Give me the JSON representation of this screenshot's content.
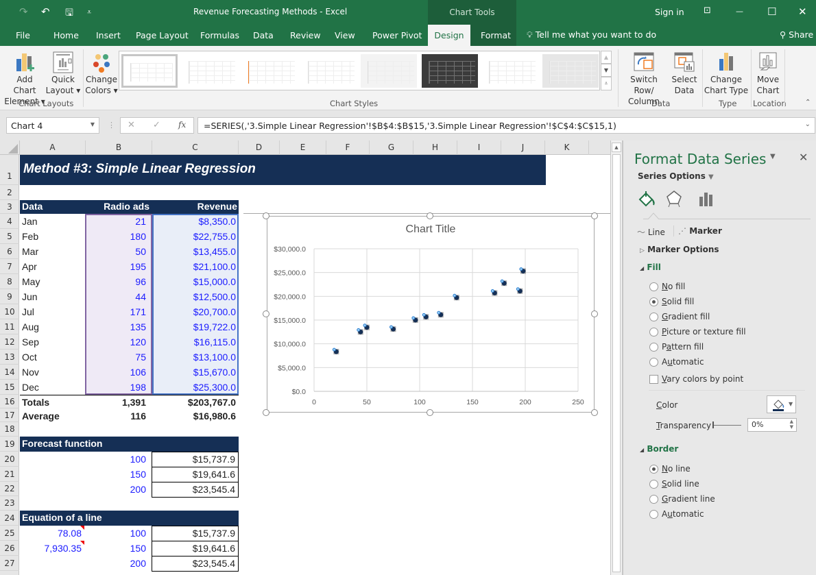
{
  "titlebar": {
    "title": "Revenue Forecasting Methods  -  Excel",
    "context_tab": "Chart Tools",
    "sign_in": "Sign in",
    "redo_icon": "↷",
    "undo_icon": "↶",
    "save_icon": "🖫",
    "customize_icon": "⩡",
    "ribbon_display_icon": "⊡",
    "minimize_icon": "—",
    "maximize_icon": "☐",
    "close_icon": "✕"
  },
  "tabs": {
    "items": [
      "File",
      "Home",
      "Insert",
      "Page Layout",
      "Formulas",
      "Data",
      "Review",
      "View",
      "Power Pivot",
      "Design",
      "Format"
    ],
    "active": "Design",
    "tell_me": "Tell me what you want to do",
    "share": "Share"
  },
  "ribbon": {
    "add_chart_element": [
      "Add Chart",
      "Element ▾"
    ],
    "quick_layout": [
      "Quick",
      "Layout ▾"
    ],
    "change_colors": [
      "Change",
      "Colors ▾"
    ],
    "chart_layouts_label": "Chart Layouts",
    "chart_styles_label": "Chart Styles",
    "switch_row_column": [
      "Switch Row/",
      "Column"
    ],
    "select_data": [
      "Select",
      "Data"
    ],
    "change_chart_type": [
      "Change",
      "Chart Type"
    ],
    "move_chart": [
      "Move",
      "Chart"
    ],
    "data_group_label": "Data",
    "type_group_label": "Type",
    "location_group_label": "Location",
    "chart_style_count": 8,
    "selected_style": 1
  },
  "formula_bar": {
    "name_box": "Chart 4",
    "formula": "=SERIES(,'3.Simple Linear Regression'!$B$4:$B$15,'3.Simple Linear Regression'!$C$4:$C$15,1)",
    "cancel_icon": "✕",
    "enter_icon": "✓",
    "fx_icon": "fx"
  },
  "columns": [
    "A",
    "B",
    "C",
    "D",
    "E",
    "F",
    "G",
    "H",
    "I",
    "J",
    "K"
  ],
  "rows": [
    "1",
    "2",
    "3",
    "4",
    "5",
    "6",
    "7",
    "8",
    "9",
    "10",
    "11",
    "12",
    "13",
    "14",
    "15",
    "16",
    "17",
    "18",
    "19",
    "20",
    "21",
    "22",
    "23",
    "24",
    "25",
    "26",
    "27"
  ],
  "sheet": {
    "title": "Method #3: Simple Linear Regression",
    "headers": {
      "data": "Data",
      "radio_ads": "Radio ads",
      "revenue": "Revenue"
    },
    "data_rows": [
      {
        "month": "Jan",
        "ads": "21",
        "revenue": "$8,350.0"
      },
      {
        "month": "Feb",
        "ads": "180",
        "revenue": "$22,755.0"
      },
      {
        "month": "Mar",
        "ads": "50",
        "revenue": "$13,455.0"
      },
      {
        "month": "Apr",
        "ads": "195",
        "revenue": "$21,100.0"
      },
      {
        "month": "May",
        "ads": "96",
        "revenue": "$15,000.0"
      },
      {
        "month": "Jun",
        "ads": "44",
        "revenue": "$12,500.0"
      },
      {
        "month": "Jul",
        "ads": "171",
        "revenue": "$20,700.0"
      },
      {
        "month": "Aug",
        "ads": "135",
        "revenue": "$19,722.0"
      },
      {
        "month": "Sep",
        "ads": "120",
        "revenue": "$16,115.0"
      },
      {
        "month": "Oct",
        "ads": "75",
        "revenue": "$13,100.0"
      },
      {
        "month": "Nov",
        "ads": "106",
        "revenue": "$15,670.0"
      },
      {
        "month": "Dec",
        "ads": "198",
        "revenue": "$25,300.0"
      }
    ],
    "totals": {
      "label": "Totals",
      "ads": "1,391",
      "revenue": "$203,767.0"
    },
    "average": {
      "label": "Average",
      "ads": "116",
      "revenue": "$16,980.6"
    },
    "forecast": {
      "title": "Forecast function",
      "rows": [
        {
          "x": "100",
          "y": "$15,737.9"
        },
        {
          "x": "150",
          "y": "$19,641.6"
        },
        {
          "x": "200",
          "y": "$23,545.4"
        }
      ]
    },
    "equation": {
      "title": "Equation of a line",
      "slope": "78.08",
      "intercept": "7,930.35",
      "rows": [
        {
          "x": "100",
          "y": "$15,737.9"
        },
        {
          "x": "150",
          "y": "$19,641.6"
        },
        {
          "x": "200",
          "y": "$23,545.4"
        }
      ]
    }
  },
  "chart_data": {
    "type": "scatter",
    "title": "Chart Title",
    "xlabel": "",
    "ylabel": "",
    "xlim": [
      0,
      250
    ],
    "ylim": [
      0,
      30000
    ],
    "xticks": [
      "0",
      "50",
      "100",
      "150",
      "200",
      "250"
    ],
    "yticks": [
      "$0.0",
      "$5,000.0",
      "$10,000.0",
      "$15,000.0",
      "$20,000.0",
      "$25,000.0",
      "$30,000.0"
    ],
    "grid": true,
    "legend": "none",
    "series": [
      {
        "name": "Revenue",
        "color": "#152f55",
        "x": [
          21,
          180,
          50,
          195,
          96,
          44,
          171,
          135,
          120,
          75,
          106,
          198
        ],
        "y": [
          8350,
          22755,
          13455,
          21100,
          15000,
          12500,
          20700,
          19722,
          16115,
          13100,
          15670,
          25300
        ]
      }
    ]
  },
  "pane": {
    "title": "Format Data Series",
    "series_options": "Series Options",
    "line_tab": "Line",
    "marker_tab": "Marker",
    "marker_options": "Marker Options",
    "fill_label": "Fill",
    "fill_options": [
      {
        "pre": "",
        "u": "N",
        "post": "o fill",
        "checked": false
      },
      {
        "pre": "",
        "u": "S",
        "post": "olid fill",
        "checked": true
      },
      {
        "pre": "",
        "u": "G",
        "post": "radient fill",
        "checked": false
      },
      {
        "pre": "",
        "u": "P",
        "post": "icture or texture fill",
        "checked": false
      },
      {
        "pre": "P",
        "u": "a",
        "post": "ttern fill",
        "checked": false
      },
      {
        "pre": "A",
        "u": "u",
        "post": "tomatic",
        "checked": false
      }
    ],
    "vary_colors": {
      "u": "V",
      "post": "ary colors by point",
      "checked": false
    },
    "color_label": {
      "u": "C",
      "post": "olor"
    },
    "transparency_label": {
      "u": "T",
      "post": "ransparency"
    },
    "transparency_value": "0%",
    "border_label": "Border",
    "border_options": [
      {
        "pre": "",
        "u": "N",
        "post": "o line",
        "checked": true
      },
      {
        "pre": "",
        "u": "S",
        "post": "olid line",
        "checked": false
      },
      {
        "pre": "",
        "u": "G",
        "post": "radient line",
        "checked": false
      },
      {
        "pre": "A",
        "u": "u",
        "post": "tomatic",
        "checked": false
      }
    ],
    "accent_color": "#217346",
    "fill_color": "#152f55"
  }
}
